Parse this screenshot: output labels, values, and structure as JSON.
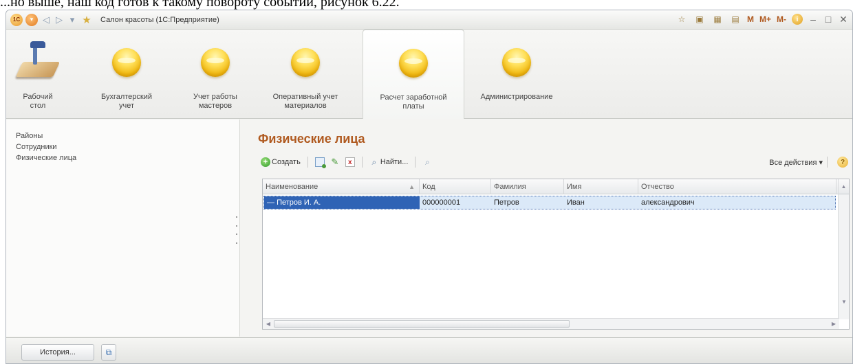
{
  "doc_text": "...но выше, наш код готов к такому повороту событий, рисунок 6.22.",
  "window": {
    "title": "Салон красоты (1С:Предприятие)",
    "logo": "1С",
    "toolbar_right": {
      "m": "M",
      "m_plus": "M+",
      "m_minus": "M-"
    }
  },
  "sections": [
    {
      "label": "Рабочий стол",
      "icon": "desktop-icon"
    },
    {
      "label": "Бухгалтерский учет",
      "icon": "orb-icon"
    },
    {
      "label": "Учет работы мастеров",
      "icon": "orb-icon"
    },
    {
      "label": "Оперативный учет материалов",
      "icon": "orb-icon"
    },
    {
      "label": "Расчет заработной платы",
      "icon": "orb-icon",
      "active": true
    },
    {
      "label": "Администрирование",
      "icon": "orb-icon"
    }
  ],
  "sidebar": {
    "items": [
      {
        "label": "Районы"
      },
      {
        "label": "Сотрудники"
      },
      {
        "label": "Физические лица"
      }
    ]
  },
  "main": {
    "title": "Физические лица",
    "toolbar": {
      "create_label": "Создать",
      "find_label": "Найти...",
      "all_actions_label": "Все действия ▾",
      "help_label": "?"
    },
    "table": {
      "columns": [
        "Наименование",
        "Код",
        "Фамилия",
        "Имя",
        "Отчество"
      ],
      "rows": [
        [
          "Петров И. А.",
          "000000001",
          "Петров",
          "Иван",
          "александрович"
        ]
      ]
    }
  },
  "status": {
    "history_label": "История..."
  },
  "colors": {
    "accent_title": "#b05a20",
    "row_selected": "#2f63b5",
    "row_background": "#dbe9f8"
  }
}
